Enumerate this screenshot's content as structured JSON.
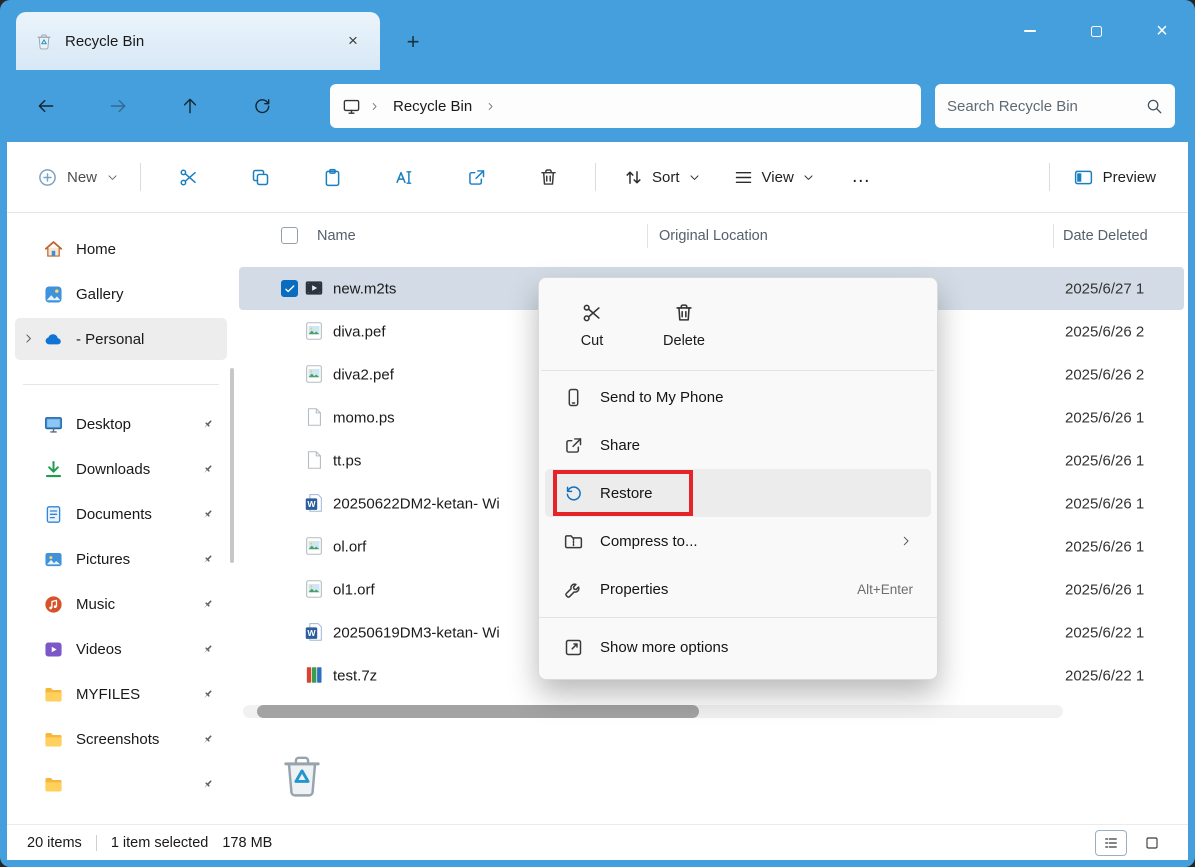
{
  "window": {
    "tab_title": "Recycle Bin"
  },
  "icons": {
    "new_tab": "+",
    "tab_close": "×",
    "close": "×",
    "more": "…"
  },
  "navbar": {
    "breadcrumb_segment": "Recycle Bin",
    "search_placeholder": "Search Recycle Bin"
  },
  "commandbar": {
    "new_label": "New",
    "sort_label": "Sort",
    "view_label": "View",
    "preview_label": "Preview"
  },
  "sidebar": {
    "top": [
      {
        "label": "Home",
        "icon": "home"
      },
      {
        "label": "Gallery",
        "icon": "gallery"
      },
      {
        "label": "- Personal",
        "icon": "onedrive",
        "selected": true,
        "expandable": true
      }
    ],
    "pinned": [
      {
        "label": "Desktop",
        "icon": "desktop"
      },
      {
        "label": "Downloads",
        "icon": "downloads"
      },
      {
        "label": "Documents",
        "icon": "documents"
      },
      {
        "label": "Pictures",
        "icon": "pictures"
      },
      {
        "label": "Music",
        "icon": "music"
      },
      {
        "label": "Videos",
        "icon": "videos"
      },
      {
        "label": "MYFILES",
        "icon": "folder"
      },
      {
        "label": "Screenshots",
        "icon": "folder"
      },
      {
        "label": "",
        "icon": "folder"
      }
    ]
  },
  "filelist": {
    "columns": [
      "Name",
      "Original Location",
      "Date Deleted"
    ],
    "rows": [
      {
        "name": "new.m2ts",
        "icon": "media",
        "date": "2025/6/27 1",
        "selected": true
      },
      {
        "name": "diva.pef",
        "icon": "image",
        "date": "2025/6/26 2"
      },
      {
        "name": "diva2.pef",
        "icon": "image",
        "date": "2025/6/26 2"
      },
      {
        "name": "momo.ps",
        "icon": "file",
        "date": "2025/6/26 1"
      },
      {
        "name": "tt.ps",
        "icon": "file",
        "date": "2025/6/26 1"
      },
      {
        "name": "20250622DM2-ketan- Wi",
        "icon": "word",
        "date": "2025/6/26 1"
      },
      {
        "name": "ol.orf",
        "icon": "image",
        "date": "2025/6/26 1"
      },
      {
        "name": "ol1.orf",
        "icon": "image",
        "date": "2025/6/26 1"
      },
      {
        "name": "20250619DM3-ketan- Wi",
        "icon": "word",
        "date": "2025/6/22 1"
      },
      {
        "name": "test.7z",
        "icon": "archive",
        "date": "2025/6/22 1"
      }
    ]
  },
  "context_menu": {
    "top_actions": [
      {
        "label": "Cut",
        "icon": "scissors"
      },
      {
        "label": "Delete",
        "icon": "trash"
      }
    ],
    "items": [
      {
        "label": "Send to My Phone",
        "icon": "phone"
      },
      {
        "label": "Share",
        "icon": "share"
      },
      {
        "label": "Restore",
        "icon": "restore",
        "highlighted": true,
        "blue": true
      },
      {
        "label": "Compress to...",
        "icon": "compress",
        "submenu": true
      },
      {
        "label": "Properties",
        "icon": "wrench",
        "shortcut": "Alt+Enter"
      },
      {
        "label": "Show more options",
        "icon": "show-more",
        "separated": true
      }
    ]
  },
  "statusbar": {
    "items": "20 items",
    "selected": "1 item selected",
    "size": "178 MB"
  }
}
